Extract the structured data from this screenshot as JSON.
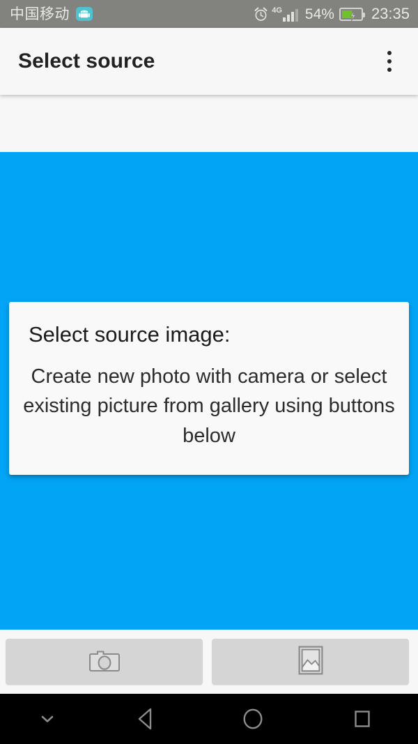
{
  "status_bar": {
    "carrier": "中国移动",
    "android_badge_icon": "android-robot-icon",
    "alarm_icon": "alarm-clock-icon",
    "network_type": "4G",
    "signal_icon": "signal-bars-icon",
    "battery_percent": "54%",
    "battery_icon": "battery-charging-icon",
    "clock": "23:35",
    "background_color": "#82827f",
    "text_color": "#e8e8e8",
    "battery_fill_color": "#6fc229"
  },
  "app_bar": {
    "title": "Select source",
    "overflow_icon": "overflow-menu-icon",
    "background_color": "#f7f7f7",
    "title_color": "#212121"
  },
  "main": {
    "background_color": "#02a4f5",
    "card": {
      "heading": "Select source image:",
      "body": "Create new photo with camera or select existing picture from gallery using buttons below",
      "background_color": "#f9f9f9"
    }
  },
  "button_bar": {
    "background_color": "#f7f7f7",
    "button_color": "#d5d5d5",
    "buttons": [
      {
        "name": "camera",
        "icon": "camera-icon",
        "label": ""
      },
      {
        "name": "gallery",
        "icon": "image-gallery-icon",
        "label": ""
      }
    ]
  },
  "nav_bar": {
    "background_color": "#000000",
    "icon_color": "#8c8c8c",
    "items": [
      {
        "name": "hide-keyboard",
        "icon": "chevron-down-icon"
      },
      {
        "name": "back",
        "icon": "back-triangle-icon"
      },
      {
        "name": "home",
        "icon": "home-circle-icon"
      },
      {
        "name": "recents",
        "icon": "recents-square-icon"
      }
    ]
  }
}
